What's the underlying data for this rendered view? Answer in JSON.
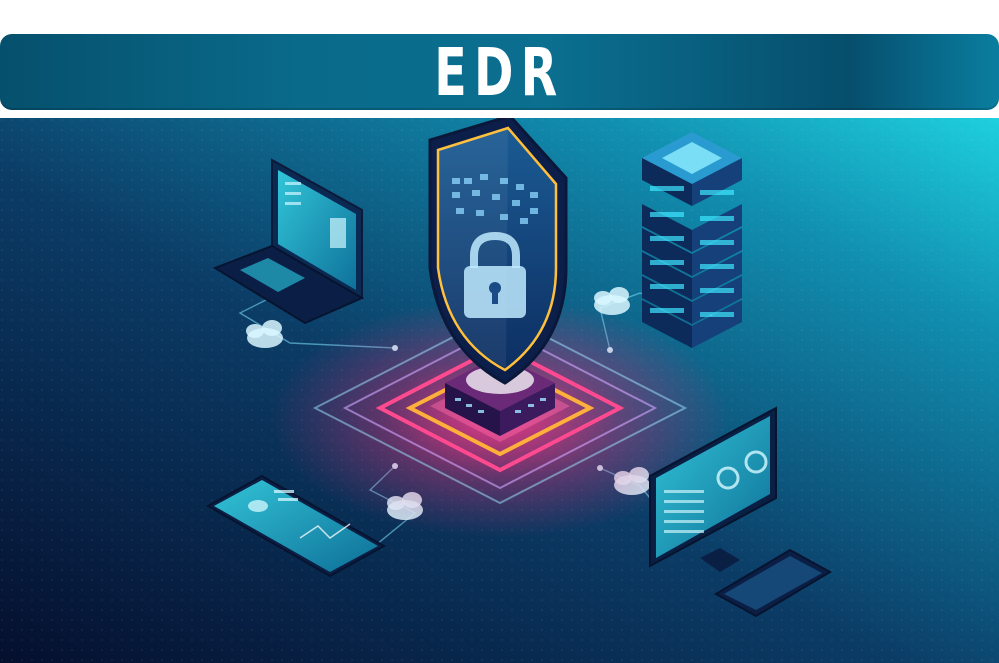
{
  "banner": {
    "title": "EDR"
  },
  "hero": {
    "icons": [
      "laptop-icon",
      "server-stack-icon",
      "shield-lock-icon",
      "tablet-icon",
      "monitor-icon",
      "keyboard-icon",
      "cloud-icon"
    ],
    "colors": {
      "background_dark": "#061a3a",
      "background_light": "#19c6d6",
      "accent_cyan": "#3fe6ff",
      "accent_pink": "#ff2d7a",
      "accent_orange": "#ffb03a"
    }
  }
}
